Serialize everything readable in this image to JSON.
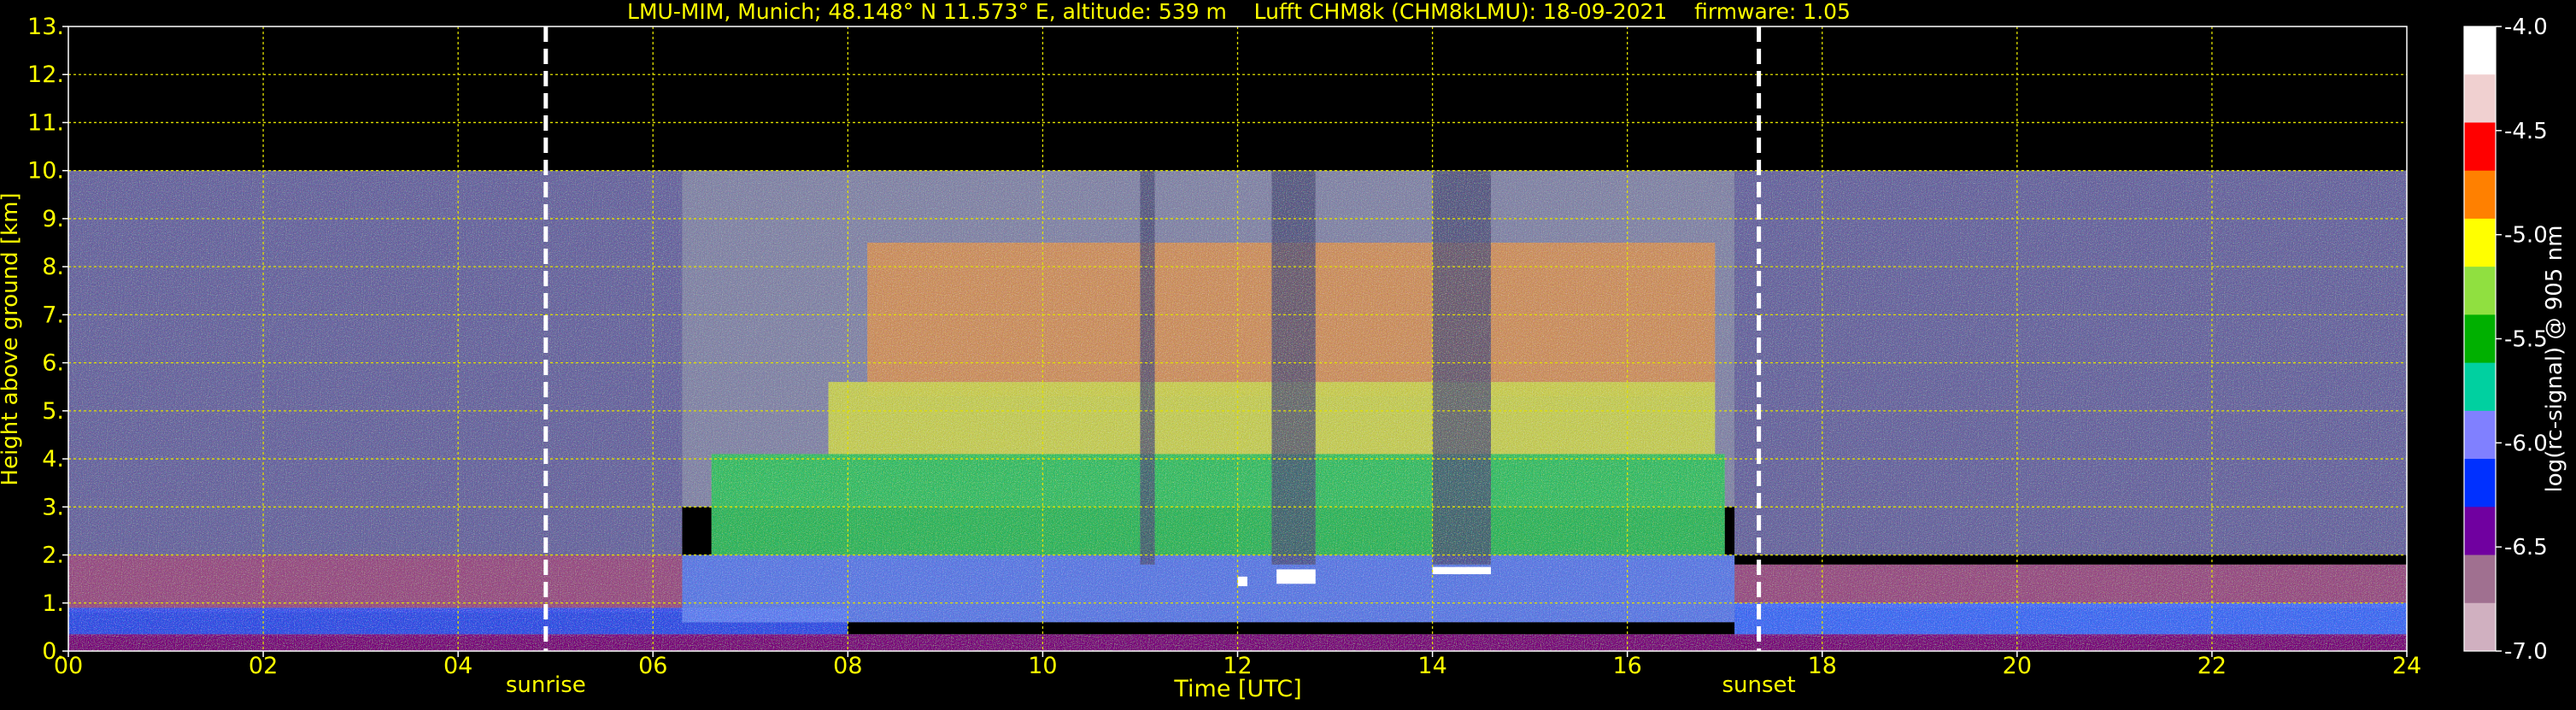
{
  "chart_data": {
    "type": "heatmap",
    "title": "LMU-MIM, Munich; 48.148° N 11.573° E, altitude: 539 m    Lufft CHM8k (CHM8kLMU): 18-09-2021    firmware: 1.05",
    "xlabel": "Time [UTC]",
    "ylabel": "Height above ground [km]",
    "xlim": [
      0,
      24
    ],
    "ylim": [
      0,
      13
    ],
    "x_ticks": [
      0,
      2,
      4,
      6,
      8,
      10,
      12,
      14,
      16,
      18,
      20,
      22,
      24
    ],
    "x_tick_labels": [
      "00",
      "02",
      "04",
      "06",
      "08",
      "10",
      "12",
      "14",
      "16",
      "18",
      "20",
      "22",
      "24"
    ],
    "y_ticks": [
      0,
      1,
      2,
      3,
      4,
      5,
      6,
      7,
      8,
      9,
      10,
      11,
      12,
      13
    ],
    "y_tick_labels": [
      "0.",
      "1.",
      "2.",
      "3.",
      "4.",
      "5.",
      "6.",
      "7.",
      "8.",
      "9.",
      "10.",
      "11.",
      "12.",
      "13."
    ],
    "grid": true,
    "data_top_km": 10,
    "annotations": [
      {
        "label": "sunrise",
        "x": 4.9
      },
      {
        "label": "sunset",
        "x": 17.35
      }
    ],
    "colorbar": {
      "label": "log(rc-signal) @ 905 nm",
      "min": -7.0,
      "max": -4.0,
      "ticks": [
        -4.0,
        -4.5,
        -5.0,
        -5.5,
        -6.0,
        -6.5,
        -7.0
      ],
      "tick_labels": [
        "-4.0",
        "-4.5",
        "-5.0",
        "-5.5",
        "-6.0",
        "-6.5",
        "-7.0"
      ],
      "colors": [
        "#ffffff",
        "#f0d0d0",
        "#ff0000",
        "#ff8000",
        "#ffff00",
        "#90e040",
        "#00b000",
        "#00d0a0",
        "#8080ff",
        "#0030ff",
        "#7000a0",
        "#a07090",
        "#d0b0c0"
      ]
    },
    "layers": [
      {
        "name": "upper-noise-quiet",
        "x": [
          0,
          6.3
        ],
        "y": [
          2,
          10
        ],
        "color": "#6e6aa8"
      },
      {
        "name": "upper-noise-day",
        "x": [
          6.3,
          17.1
        ],
        "y": [
          3,
          10
        ],
        "color": "#8a8cb0"
      },
      {
        "name": "upper-noise-night",
        "x": [
          17.1,
          24
        ],
        "y": [
          2,
          10
        ],
        "color": "#6e6aa8"
      },
      {
        "name": "daytime-orange",
        "x": [
          8.2,
          16.9
        ],
        "y": [
          5.3,
          8.5
        ],
        "color": "#d0905a"
      },
      {
        "name": "daytime-yellow",
        "x": [
          7.8,
          16.9
        ],
        "y": [
          4.0,
          5.6
        ],
        "color": "#c8d050"
      },
      {
        "name": "daytime-green",
        "x": [
          6.6,
          17.0
        ],
        "y": [
          2.0,
          4.1
        ],
        "color": "#30c060"
      },
      {
        "name": "residual-layer-morning",
        "x": [
          0,
          6.3
        ],
        "y": [
          0.8,
          2.0
        ],
        "color": "#a0508a"
      },
      {
        "name": "residual-layer-evening",
        "x": [
          17.1,
          24
        ],
        "y": [
          0.9,
          1.8
        ],
        "color": "#a0508a"
      },
      {
        "name": "boundary-layer-blue-morning",
        "x": [
          0,
          8.0
        ],
        "y": [
          0.3,
          0.9
        ],
        "color": "#3050f0"
      },
      {
        "name": "boundary-layer-blue-day",
        "x": [
          6.3,
          17.1
        ],
        "y": [
          0.6,
          2.0
        ],
        "color": "#6080f0"
      },
      {
        "name": "boundary-layer-blue-evening",
        "x": [
          17.1,
          24
        ],
        "y": [
          0.3,
          1.0
        ],
        "color": "#4070ff"
      },
      {
        "name": "surface-layer",
        "x": [
          0,
          24
        ],
        "y": [
          0,
          0.35
        ],
        "color": "#800080"
      }
    ],
    "clouds": [
      {
        "x": [
          12.0,
          12.1
        ],
        "y": [
          1.35,
          1.55
        ]
      },
      {
        "x": [
          12.4,
          12.8
        ],
        "y": [
          1.4,
          1.7
        ]
      },
      {
        "x": [
          14.0,
          14.6
        ],
        "y": [
          1.6,
          1.75
        ]
      }
    ],
    "dark_columns": [
      {
        "x": [
          11.0,
          11.15
        ]
      },
      {
        "x": [
          12.35,
          12.8
        ]
      },
      {
        "x": [
          14.0,
          14.6
        ]
      }
    ]
  }
}
